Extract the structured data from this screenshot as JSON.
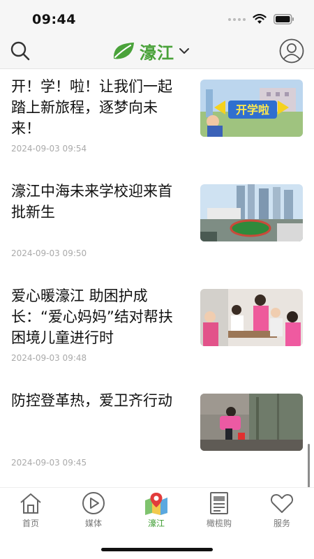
{
  "status_bar": {
    "time": "09:44"
  },
  "header": {
    "brand_name": "濠江"
  },
  "news": [
    {
      "title": "开！学！啦！让我们一起踏上新旅程，逐梦向未来！",
      "date": "2024-09-03 09:54",
      "thumb_text": "开学啦"
    },
    {
      "title": "濠江中海未来学校迎来首批新生",
      "date": "2024-09-03 09:50"
    },
    {
      "title": "爱心暖濠江 助困护成长：“爱心妈妈”结对帮扶困境儿童进行时",
      "date": "2024-09-03 09:48"
    },
    {
      "title": "防控登革热，爱卫齐行动",
      "date": "2024-09-03 09:45"
    }
  ],
  "tabs": [
    {
      "label": "首页",
      "icon": "home-icon"
    },
    {
      "label": "媒体",
      "icon": "play-icon"
    },
    {
      "label": "濠江",
      "icon": "map-pin-icon",
      "active": true
    },
    {
      "label": "橄榄购",
      "icon": "newspaper-icon"
    },
    {
      "label": "服务",
      "icon": "heart-icon"
    }
  ],
  "colors": {
    "accent": "#4aa23a",
    "active_tab": "#3b9b2e"
  }
}
